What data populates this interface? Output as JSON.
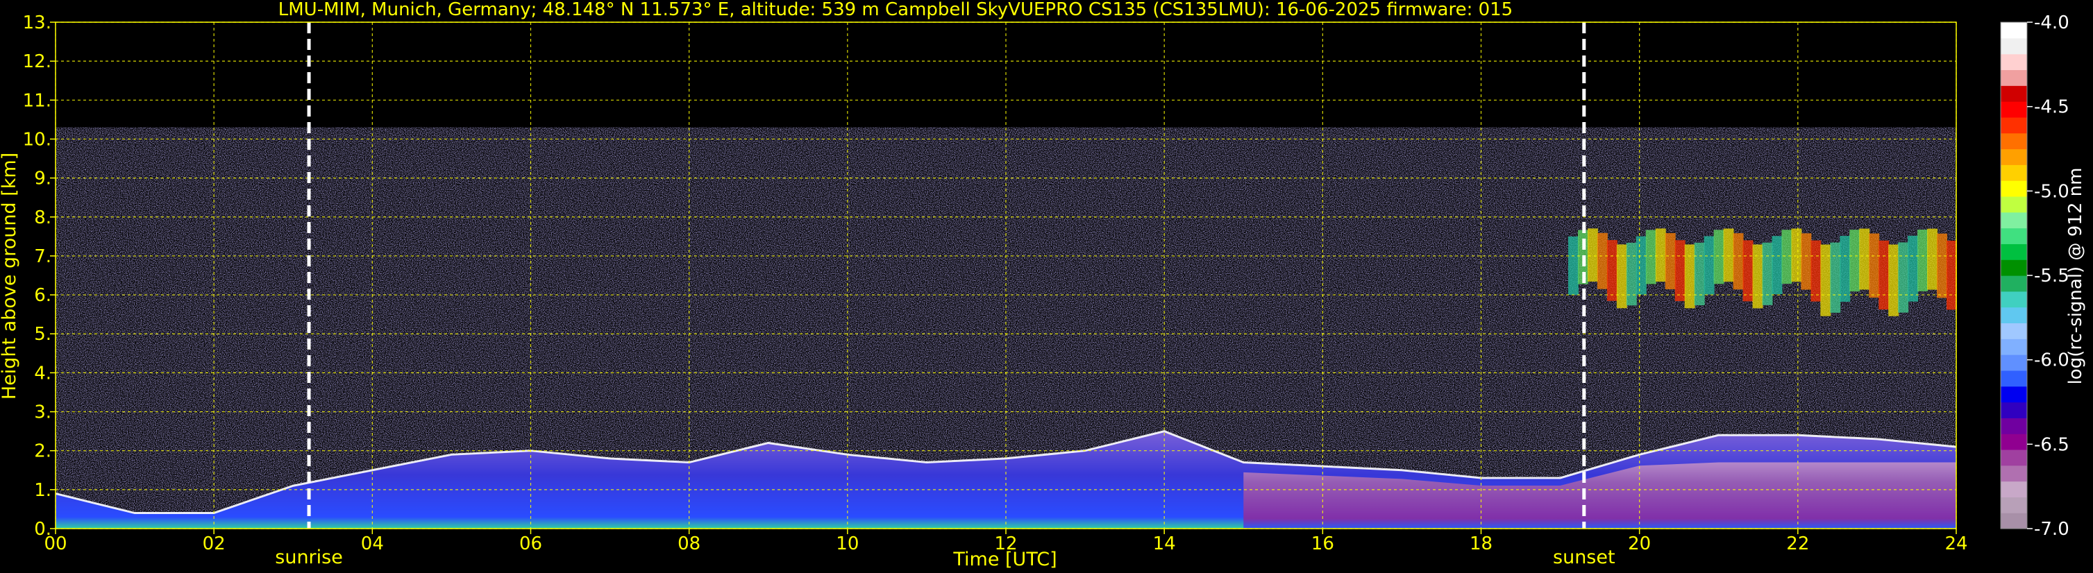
{
  "title": "LMU-MIM, Munich, Germany; 48.148° N 11.573° E, altitude: 539 m    Campbell SkyVUEPRO CS135 (CS135LMU): 16-06-2025    firmware: 015",
  "colors": {
    "background": "#000000",
    "axis_text": "#ffff00",
    "grid": "#ffff00",
    "markers": "#ffffff"
  },
  "chart_data": {
    "type": "heatmap",
    "title": "LMU-MIM, Munich, Germany; 48.148° N 11.573° E, altitude: 539 m    Campbell SkyVUEPRO CS135 (CS135LMU): 16-06-2025    firmware: 015",
    "xlabel": "Time [UTC]",
    "ylabel": "Height above ground [km]",
    "xlim": [
      0,
      24
    ],
    "ylim": [
      0,
      13
    ],
    "x_ticks": [
      "00",
      "02",
      "04",
      "06",
      "08",
      "10",
      "12",
      "14",
      "16",
      "18",
      "20",
      "22",
      "24"
    ],
    "y_ticks": [
      "0.",
      "1.",
      "2.",
      "3.",
      "4.",
      "5.",
      "6.",
      "7.",
      "8.",
      "9.",
      "10.",
      "11.",
      "12.",
      "13."
    ],
    "grid": true,
    "markers": [
      {
        "label": "sunrise",
        "x": 3.2
      },
      {
        "label": "sunset",
        "x": 19.3
      }
    ],
    "colorbar": {
      "label": "log(rc-signal) @ 912 nm",
      "range": [
        -7.0,
        -4.0
      ],
      "ticks": [
        "-4.0",
        "-4.5",
        "-5.0",
        "-5.5",
        "-6.0",
        "-6.5",
        "-7.0"
      ],
      "colors": [
        "#a890a8",
        "#b8a0b8",
        "#c8a8c8",
        "#b070b0",
        "#a040a0",
        "#900090",
        "#7000a0",
        "#3000c0",
        "#0000f0",
        "#3060ff",
        "#6090ff",
        "#80b0ff",
        "#a0c8ff",
        "#60c8f0",
        "#40d0c0",
        "#20b060",
        "#009000",
        "#00c040",
        "#40e080",
        "#80f0a0",
        "#c0ff40",
        "#ffff00",
        "#ffd000",
        "#ffa000",
        "#ff7000",
        "#ff3000",
        "#ff0000",
        "#d00000",
        "#f0a0a0",
        "#ffd0d0",
        "#f0f0f0",
        "#ffffff"
      ]
    },
    "features": [
      {
        "name": "boundary layer top",
        "x": [
          0,
          1,
          2,
          3,
          4,
          5,
          6,
          7,
          8,
          9,
          10,
          11,
          12,
          13,
          14,
          15,
          16,
          17,
          18,
          19,
          20,
          21,
          22,
          23,
          24
        ],
        "y": [
          0.9,
          0.4,
          0.4,
          1.1,
          1.5,
          1.9,
          2.0,
          1.8,
          1.7,
          2.2,
          1.9,
          1.7,
          1.8,
          2.0,
          2.5,
          1.7,
          1.6,
          1.5,
          1.3,
          1.3,
          1.9,
          2.4,
          2.4,
          2.3,
          2.1
        ]
      },
      {
        "name": "noise ceiling",
        "y_km": 10.3
      },
      {
        "name": "cirrus layer",
        "x_start": 19.1,
        "x_end": 24,
        "y_low": 6.0,
        "y_high": 7.5
      }
    ]
  }
}
